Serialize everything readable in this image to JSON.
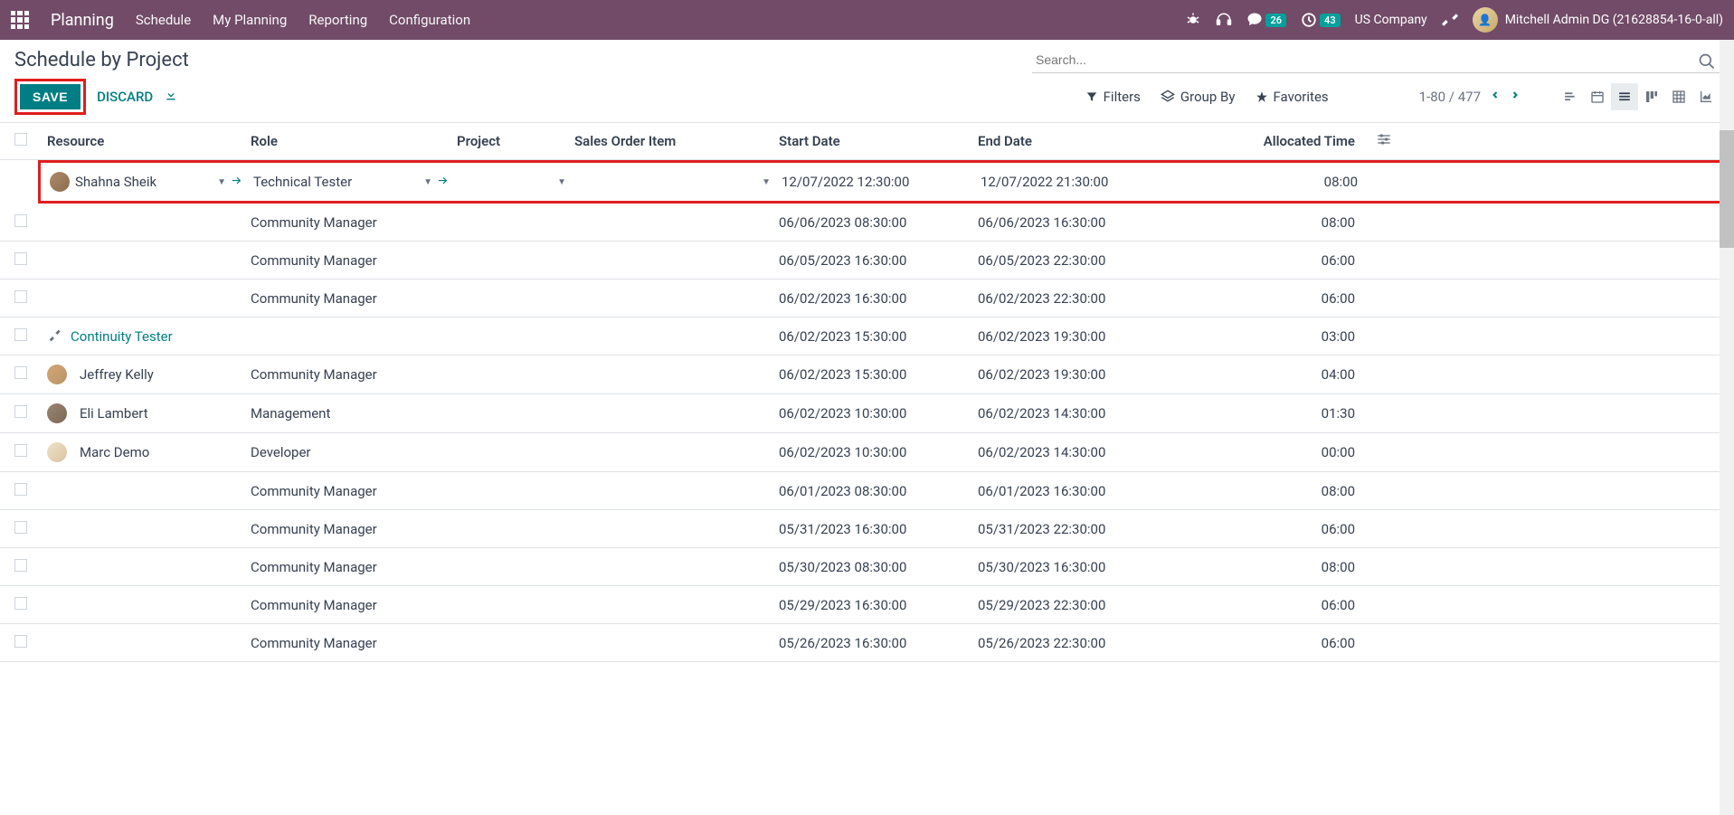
{
  "navbar": {
    "app_name": "Planning",
    "menu": [
      "Schedule",
      "My Planning",
      "Reporting",
      "Configuration"
    ],
    "messages_count": "26",
    "activities_count": "43",
    "company": "US Company",
    "user": "Mitchell Admin DG (21628854-16-0-all)"
  },
  "control_panel": {
    "title": "Schedule by Project",
    "save_label": "SAVE",
    "discard_label": "DISCARD",
    "search_placeholder": "Search...",
    "filters_label": "Filters",
    "groupby_label": "Group By",
    "favorites_label": "Favorites",
    "pager": "1-80 / 477"
  },
  "table": {
    "headers": {
      "resource": "Resource",
      "role": "Role",
      "project": "Project",
      "sales_order": "Sales Order Item",
      "start_date": "Start Date",
      "end_date": "End Date",
      "allocated_time": "Allocated Time"
    },
    "rows": [
      {
        "highlighted": true,
        "resource": "Shahna Sheik",
        "avatar": "avatar-1",
        "has_avatar": true,
        "editable": true,
        "role": "Technical Tester",
        "start": "12/07/2022 12:30:00",
        "end": "12/07/2022 21:30:00",
        "time": "08:00"
      },
      {
        "resource": "",
        "role": "Community Manager",
        "start": "06/06/2023 08:30:00",
        "end": "06/06/2023 16:30:00",
        "time": "08:00"
      },
      {
        "resource": "",
        "role": "Community Manager",
        "start": "06/05/2023 16:30:00",
        "end": "06/05/2023 22:30:00",
        "time": "06:00"
      },
      {
        "resource": "",
        "role": "Community Manager",
        "start": "06/02/2023 16:30:00",
        "end": "06/02/2023 22:30:00",
        "time": "06:00"
      },
      {
        "resource": "Continuity Tester",
        "wrench": true,
        "link": true,
        "role": "",
        "start": "06/02/2023 15:30:00",
        "end": "06/02/2023 19:30:00",
        "time": "03:00"
      },
      {
        "resource": "Jeffrey Kelly",
        "avatar": "avatar-2",
        "has_avatar": true,
        "role": "Community Manager",
        "start": "06/02/2023 15:30:00",
        "end": "06/02/2023 19:30:00",
        "time": "04:00"
      },
      {
        "resource": "Eli Lambert",
        "avatar": "avatar-3",
        "has_avatar": true,
        "role": "Management",
        "start": "06/02/2023 10:30:00",
        "end": "06/02/2023 14:30:00",
        "time": "01:30"
      },
      {
        "resource": "Marc Demo",
        "avatar": "avatar-4",
        "has_avatar": true,
        "role": "Developer",
        "start": "06/02/2023 10:30:00",
        "end": "06/02/2023 14:30:00",
        "time": "00:00"
      },
      {
        "resource": "",
        "role": "Community Manager",
        "start": "06/01/2023 08:30:00",
        "end": "06/01/2023 16:30:00",
        "time": "08:00"
      },
      {
        "resource": "",
        "role": "Community Manager",
        "start": "05/31/2023 16:30:00",
        "end": "05/31/2023 22:30:00",
        "time": "06:00"
      },
      {
        "resource": "",
        "role": "Community Manager",
        "start": "05/30/2023 08:30:00",
        "end": "05/30/2023 16:30:00",
        "time": "08:00"
      },
      {
        "resource": "",
        "role": "Community Manager",
        "start": "05/29/2023 16:30:00",
        "end": "05/29/2023 22:30:00",
        "time": "06:00"
      },
      {
        "resource": "",
        "role": "Community Manager",
        "start": "05/26/2023 16:30:00",
        "end": "05/26/2023 22:30:00",
        "time": "06:00"
      }
    ]
  }
}
